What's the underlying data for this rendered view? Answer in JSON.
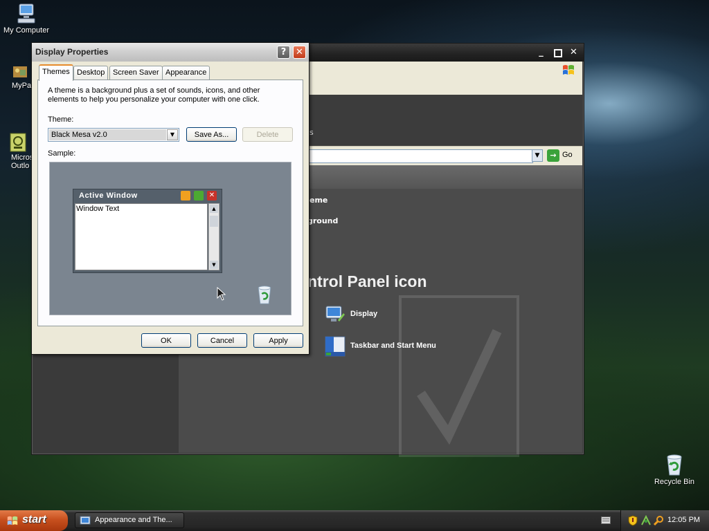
{
  "desktop": {
    "icons": [
      {
        "label": "My Computer"
      },
      {
        "label": "MyPa"
      },
      {
        "label": "Micros\nOutlo"
      },
      {
        "label": "Recycle Bin"
      }
    ]
  },
  "bg_window": {
    "go_label": "Go",
    "partial_texts": [
      "s",
      "eme",
      "ground"
    ],
    "pick_icon_heading": "ntrol Panel icon",
    "items": [
      {
        "label": "Display",
        "icon": "display-icon"
      },
      {
        "label": "Taskbar and Start Menu",
        "icon": "taskbar-icon"
      }
    ]
  },
  "dialog": {
    "title": "Display Properties",
    "tabs": [
      "Themes",
      "Desktop",
      "Screen Saver",
      "Appearance"
    ],
    "active_tab": "Themes",
    "description": "A theme is a background plus a set of sounds, icons, and other elements to help you personalize your computer with one click.",
    "theme_label": "Theme:",
    "theme_value": "Black Mesa v2.0",
    "save_as_label": "Save As...",
    "delete_label": "Delete",
    "sample_label": "Sample:",
    "sample": {
      "window_title": "Active Window",
      "window_text": "Window Text"
    },
    "ok_label": "OK",
    "cancel_label": "Cancel",
    "apply_label": "Apply"
  },
  "taskbar": {
    "start_label": "start",
    "task_label": "Appearance and The...",
    "clock": "12:05 PM"
  },
  "colors": {
    "xp_orange": "#e68b2c",
    "start_button": "#c8501e",
    "dialog_face": "#ece9d8"
  }
}
